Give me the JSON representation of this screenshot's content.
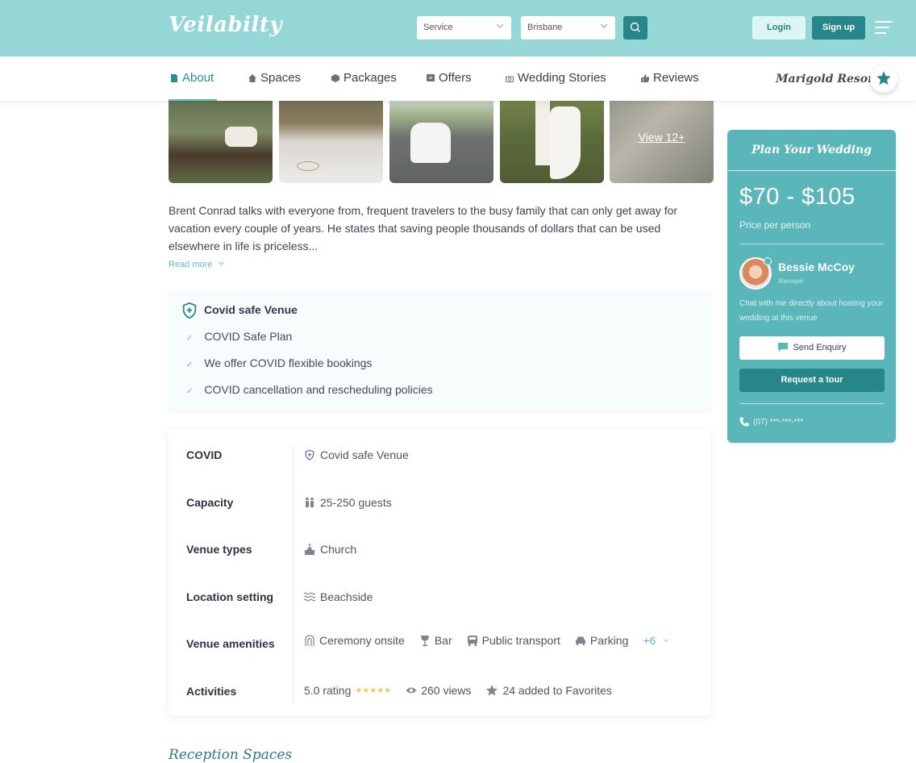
{
  "header": {
    "logo": "Veilabilty",
    "service_select": "Service",
    "location_select": "Brisbane",
    "login_label": "Login",
    "signup_label": "Sign up"
  },
  "nav": {
    "items": [
      {
        "label": "About",
        "icon": "document-icon",
        "active": true
      },
      {
        "label": "Spaces",
        "icon": "home-icon"
      },
      {
        "label": "Packages",
        "icon": "box-icon"
      },
      {
        "label": "Offers",
        "icon": "tag-icon"
      },
      {
        "label": "Wedding Stories",
        "icon": "camera-icon"
      },
      {
        "label": "Reviews",
        "icon": "thumbs-up-icon"
      }
    ],
    "venue_name": "Marigold Resort"
  },
  "gallery": {
    "view_more_label": "View 12+"
  },
  "about": {
    "description": "Brent Conrad talks with everyone from, frequent travelers to the busy family that can only get away for vacation every couple of years. He states that saving people thousands of dollars that can be used elsewhere in life is priceless...",
    "read_more": "Read more"
  },
  "covid": {
    "title": "Covid safe Venue",
    "items": [
      "COVID Safe Plan",
      "We offer COVID flexible bookings",
      "COVID cancellation and rescheduling policies"
    ]
  },
  "details": {
    "covid": {
      "label": "COVID",
      "value": "Covid safe Venue"
    },
    "capacity": {
      "label": "Capacity",
      "value": "25-250 guests"
    },
    "venue_types": {
      "label": "Venue types",
      "value": "Church"
    },
    "location": {
      "label": "Location setting",
      "value": "Beachside"
    },
    "amenities": {
      "label": "Venue amenities",
      "items": [
        "Ceremony onsite",
        "Bar",
        "Public transport",
        "Parking"
      ],
      "more": "+6"
    },
    "activities": {
      "label": "Activities",
      "rating": "5.0 rating",
      "stars": "★★★★★",
      "views": "260 views",
      "favorites": "24 added to Favorites"
    }
  },
  "reception": {
    "title": "Reception Spaces"
  },
  "sidebar": {
    "title": "Plan Your Wedding",
    "price": "$70 - $105",
    "price_label": "Price per person",
    "manager_name": "Bessie McCoy",
    "manager_role": "Manager",
    "chat_text": "Chat with me directly about hosting your wedding at this venue",
    "enquiry_label": "Send Enquiry",
    "tour_label": "Request a tour",
    "phone": "(07) ***-***-***"
  },
  "colors": {
    "header_bg": "#95d6d6",
    "accent_dark": "#27868a",
    "accent": "#5bb6ba",
    "star": "#f2c94c"
  }
}
